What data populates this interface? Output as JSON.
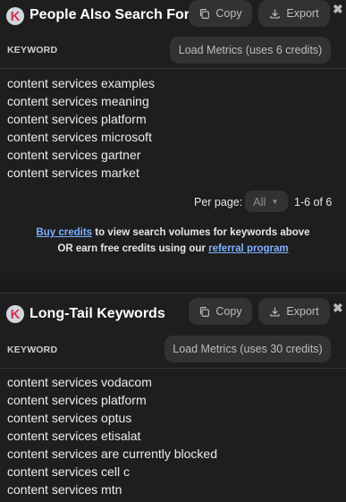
{
  "panel1": {
    "title": "People Also Search For",
    "copy_label": "Copy",
    "export_label": "Export",
    "column_header": "KEYWORD",
    "load_metrics_label": "Load Metrics (uses 6 credits)",
    "keywords": [
      "content services examples",
      "content services meaning",
      "content services platform",
      "content services microsoft",
      "content services gartner",
      "content services market"
    ],
    "per_page_label": "Per page:",
    "per_page_value": "All",
    "range_text": "1-6 of 6",
    "buy_credits_link": "Buy credits",
    "buy_credits_rest": " to view search volumes for keywords above",
    "earn_prefix": "OR earn free credits using our ",
    "referral_link": "referral program"
  },
  "panel2": {
    "title": "Long-Tail Keywords",
    "copy_label": "Copy",
    "export_label": "Export",
    "column_header": "KEYWORD",
    "load_metrics_label": "Load Metrics (uses 30 credits)",
    "keywords": [
      "content services vodacom",
      "content services platform",
      "content services optus",
      "content services etisalat",
      "content services are currently blocked",
      "content services cell c",
      "content services mtn"
    ]
  },
  "logo_letter": "K",
  "icons": {
    "copy": "copy-icon",
    "export": "download-icon",
    "close": "close-icon",
    "select": "chevron-down-icon"
  },
  "colors": {
    "background": "#1e1e1f",
    "button": "#323234",
    "link": "#7fb0ff",
    "logo_letter": "#d6314d"
  }
}
